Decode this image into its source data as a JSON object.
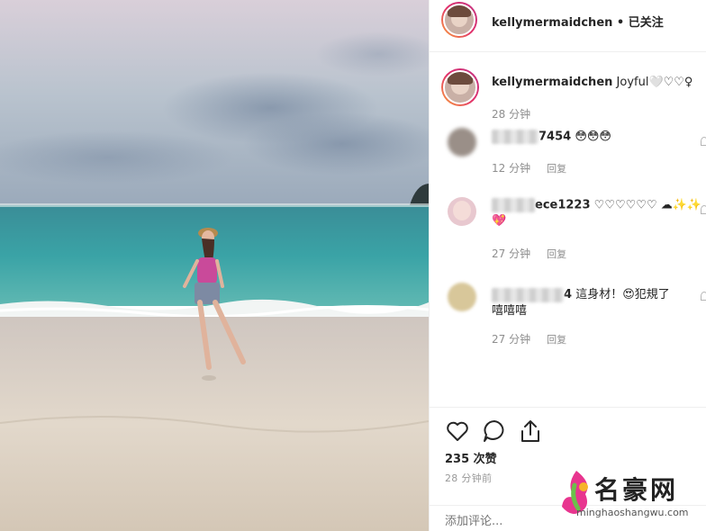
{
  "post": {
    "username": "kellymermaidchen",
    "follow_separator": " • ",
    "follow_status": "已关注",
    "caption_text": "Joyful🤍♡♡♀",
    "caption_time": "28 分钟"
  },
  "comments": [
    {
      "user_visible": "7454",
      "text": "😳😳😳",
      "time": "12 分钟",
      "reply": "回复"
    },
    {
      "user_visible": "ece1223",
      "text": "♡♡♡♡♡♡ ☁✨✨",
      "text_line2": "💖",
      "time": "27 分钟",
      "reply": "回复"
    },
    {
      "user_visible": "4",
      "text": "這身材！😍犯規了",
      "text_line2": "嘻嘻嘻",
      "time": "27 分钟",
      "reply": "回复"
    }
  ],
  "actions": {
    "like_icon": "heart-icon",
    "comment_icon": "comment-bubble-icon",
    "share_icon": "share-icon"
  },
  "likes": "235 次赞",
  "time_ago": "28 分钟前",
  "comment_placeholder": "添加评论...",
  "watermark": {
    "title": "名豪网",
    "url": "minghaoshangwu.com"
  },
  "colors": {
    "sky_top": "#d8d0da",
    "sea": "#2f8f96",
    "sand": "#d8cfc4",
    "swimsuit": "#c94a9a"
  }
}
